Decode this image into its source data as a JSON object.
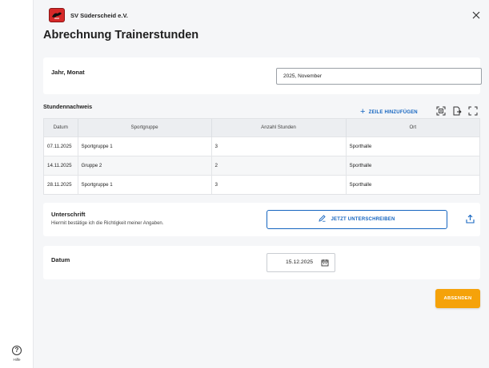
{
  "app": {
    "club_name": "SV Süderscheid e.V.",
    "page_title": "Abrechnung Trainerstunden",
    "help_label": "Hilfe"
  },
  "year_month": {
    "label": "Jahr, Monat",
    "value": "2025, November"
  },
  "hours_section": {
    "title": "Stundennachweis",
    "add_row_label": "ZEILE HINZUFÜGEN",
    "columns": [
      "Datum",
      "Sportgruppe",
      "Anzahl Stunden",
      "Ort"
    ],
    "rows": [
      {
        "datum": "07.11.2025",
        "sportgruppe": "Sportgruppe 1",
        "stunden": "3",
        "ort": "Sporthalle"
      },
      {
        "datum": "14.11.2025",
        "sportgruppe": "Gruppe 2",
        "stunden": "2",
        "ort": "Sporthalle"
      },
      {
        "datum": "28.11.2025",
        "sportgruppe": "Sportgruppe 1",
        "stunden": "3",
        "ort": "Sporthalle"
      }
    ]
  },
  "signature": {
    "label": "Unterschrift",
    "subtitle": "Hiermit bestätige ich die Richtigkeit meiner Angaben.",
    "button_label": "JETZT UNTERSCHREIBEN"
  },
  "date_section": {
    "label": "Datum",
    "value": "15.12.2025"
  },
  "submit_label": "ABSENDEN",
  "colors": {
    "accent_blue": "#1565c0",
    "submit_orange": "#f5a20a",
    "logo_red": "#d62828"
  },
  "icons": {
    "close": "close-icon",
    "help": "help-icon",
    "add": "plus-icon",
    "tools": [
      "scan-icon",
      "file-export-icon",
      "fullscreen-icon"
    ],
    "pen": "pen-icon",
    "upload": "upload-icon",
    "calendar": "calendar-icon"
  }
}
